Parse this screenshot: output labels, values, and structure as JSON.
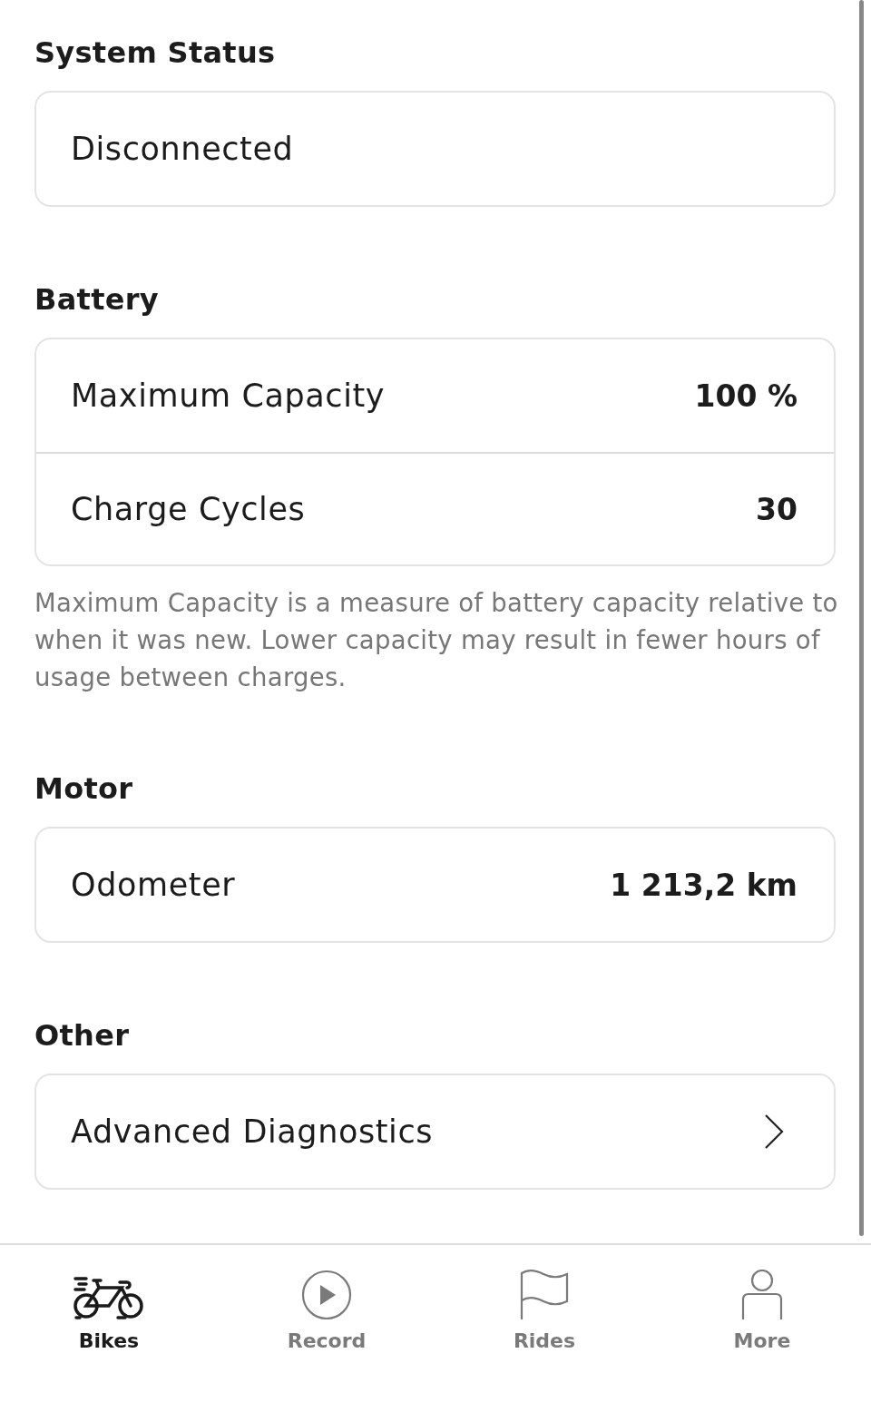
{
  "sections": [
    {
      "title": "System Status",
      "rows": [
        {
          "kind": "status",
          "label": "Disconnected"
        }
      ]
    },
    {
      "title": "Battery",
      "rows": [
        {
          "kind": "value",
          "label": "Maximum Capacity",
          "value": "100 %"
        },
        {
          "kind": "value",
          "label": "Charge Cycles",
          "value": "30"
        }
      ],
      "note": "Maximum Capacity is a measure of battery capacity relative to when it was new. Lower capacity may result in fewer hours of usage between charges."
    },
    {
      "title": "Motor",
      "rows": [
        {
          "kind": "value",
          "label": "Odometer",
          "value": "1 213,2 km"
        }
      ]
    },
    {
      "title": "Other",
      "rows": [
        {
          "kind": "link",
          "label": "Advanced Diagnostics"
        }
      ]
    }
  ],
  "tab_bar": [
    {
      "kind": "bike",
      "label": "Bikes",
      "selected": true
    },
    {
      "kind": "record",
      "label": "Record",
      "selected": false
    },
    {
      "kind": "flag",
      "label": "Rides",
      "selected": false
    },
    {
      "kind": "person",
      "label": "More",
      "selected": false
    }
  ]
}
